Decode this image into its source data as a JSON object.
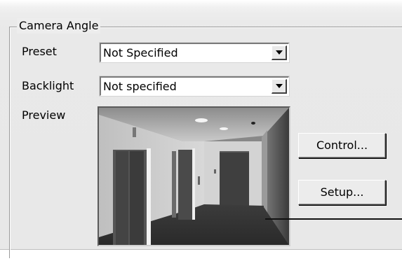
{
  "group": {
    "title": "Camera Angle"
  },
  "preset": {
    "label": "Preset",
    "value": "Not Specified"
  },
  "backlight": {
    "label": "Backlight",
    "value": "Not specified"
  },
  "preview": {
    "label": "Preview"
  },
  "buttons": {
    "control_label": "Control...",
    "setup_label": "Setup..."
  },
  "icons": {
    "combo_arrow": "chevron-down-icon"
  },
  "colors": {
    "dialog_bg": "#e8e8e8",
    "groupbox_border": "#9a9a9a",
    "field_bg": "#ffffff",
    "callout": "#111111"
  }
}
